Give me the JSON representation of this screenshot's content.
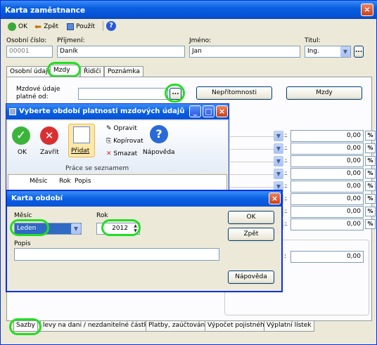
{
  "window": {
    "title": "Karta zaměstnance",
    "close": "×"
  },
  "toolbar": {
    "ok": "OK",
    "back": "Zpět",
    "apply": "Použít",
    "help": "?"
  },
  "employee": {
    "id_label": "Osobní číslo:",
    "id_value": "00001",
    "surname_label": "Příjmení:",
    "surname_value": "Daník",
    "name_label": "Jméno:",
    "name_value": "Jan",
    "title_label": "Titul:",
    "title_value": "Ing."
  },
  "tabs": [
    "Osobní údaje",
    "Mzdy",
    "Řidiči",
    "Poznámka"
  ],
  "wage": {
    "label1": "Mzdové údaje",
    "label2": "platné od:",
    "absences": "Nepřítomnosti",
    "wages": "Mzdy",
    "more": "..."
  },
  "right_rows": {
    "values": [
      "0,00",
      "0,00",
      "0,00",
      "0,00",
      "0,00",
      "0,00",
      "0,00",
      "0,00",
      "0,00"
    ],
    "pct": "%",
    "bottom_value": "0,00"
  },
  "period_dialog": {
    "title": "Vyberte období platnosti mzdových údajů",
    "ribbon": {
      "ok": "OK",
      "close": "Zavřít",
      "add": "Přidat",
      "edit": "Opravit",
      "copy": "Kopírovat",
      "delete": "Smazat",
      "help": "Nápověda",
      "group": "Práce se seznamem"
    },
    "columns": [
      "Měsíc",
      "Rok",
      "Popis"
    ]
  },
  "obdobi_dialog": {
    "title": "Karta období",
    "month_label": "Měsíc",
    "month_value": "Leden",
    "year_label": "Rok",
    "year_value": "2012",
    "desc_label": "Popis",
    "desc_value": "",
    "ok": "OK",
    "back": "Zpět",
    "help": "Nápověda"
  },
  "bottom_tabs": [
    "Sazby",
    "levy na dani / nezdanitelné částky",
    "Platby, zaúčtování",
    "Výpočet pojistného",
    "Výplatní lístek"
  ]
}
